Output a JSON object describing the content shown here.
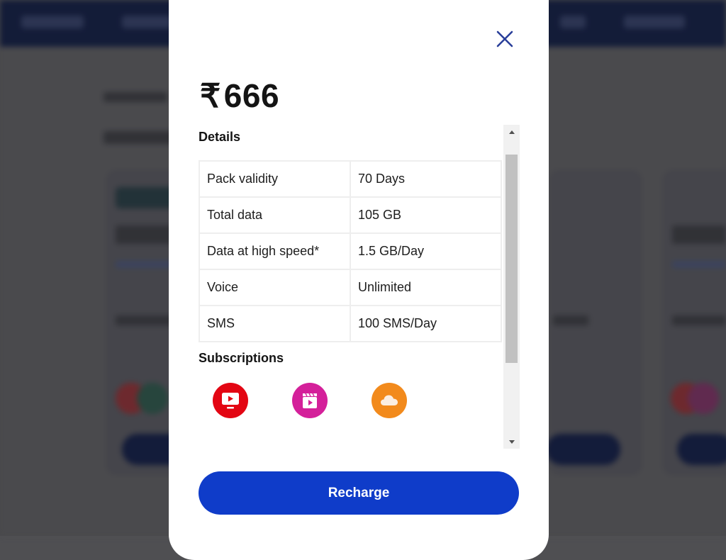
{
  "colors": {
    "accent": "#0f3cc9",
    "close_icon": "#2a3f9a",
    "overlay_nav": "#101a3a",
    "sub_icon_tv": "#e30613",
    "sub_icon_cinema": "#d4209a",
    "sub_icon_cloud": "#f28a1c"
  },
  "modal": {
    "currency_symbol": "₹",
    "price": "666",
    "details_title": "Details",
    "details": [
      {
        "label": "Pack validity",
        "value": "70 Days"
      },
      {
        "label": "Total data",
        "value": "105 GB"
      },
      {
        "label": "Data at high speed*",
        "value": "1.5 GB/Day"
      },
      {
        "label": "Voice",
        "value": "Unlimited"
      },
      {
        "label": "SMS",
        "value": "100 SMS/Day"
      }
    ],
    "subscriptions_title": "Subscriptions",
    "subscriptions": [
      {
        "icon": "tv-play-icon"
      },
      {
        "icon": "cinema-clapper-icon"
      },
      {
        "icon": "cloud-icon"
      }
    ],
    "recharge_label": "Recharge",
    "close_icon": "close-icon"
  }
}
